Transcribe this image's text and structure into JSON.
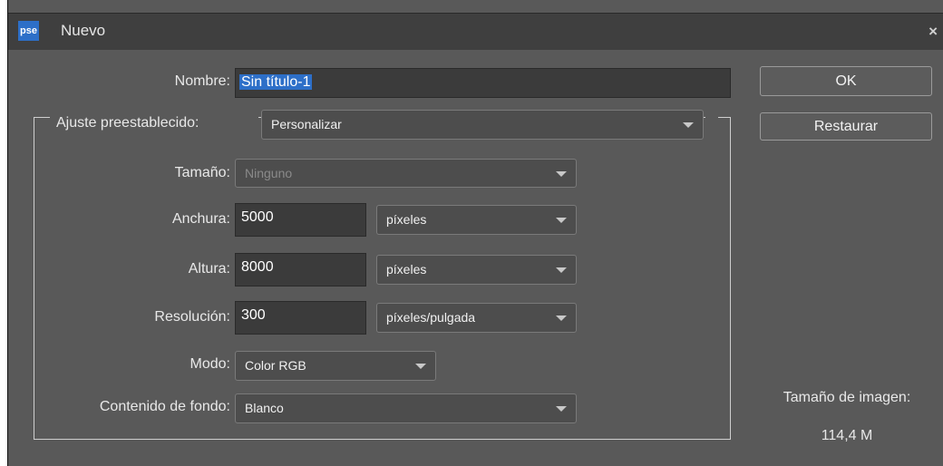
{
  "window": {
    "app_logo": "pse",
    "title": "Nuevo",
    "close": "×"
  },
  "nombre": {
    "label": "Nombre:",
    "value": "Sin título-1"
  },
  "preset": {
    "label": "Ajuste preestablecido:",
    "value": "Personalizar"
  },
  "tamano": {
    "label": "Tamaño:",
    "value": "Ninguno"
  },
  "anchura": {
    "label": "Anchura:",
    "value": "5000",
    "unit": "píxeles"
  },
  "altura": {
    "label": "Altura:",
    "value": "8000",
    "unit": "píxeles"
  },
  "resolucion": {
    "label": "Resolución:",
    "value": "300",
    "unit": "píxeles/pulgada"
  },
  "modo": {
    "label": "Modo:",
    "value": "Color RGB"
  },
  "fondo": {
    "label": "Contenido de fondo:",
    "value": "Blanco"
  },
  "buttons": {
    "ok": "OK",
    "restaurar": "Restaurar"
  },
  "image_size": {
    "label": "Tamaño de imagen:",
    "value": "114,4 M"
  },
  "colors": {
    "background": "#595959",
    "title_bar": "#3f3f3f",
    "selection": "#2d6fc8",
    "field": "#3b3b3b"
  },
  "icons": {
    "logo": "pse-logo-icon",
    "close": "close-icon",
    "dropdown": "chevron-down-icon"
  }
}
